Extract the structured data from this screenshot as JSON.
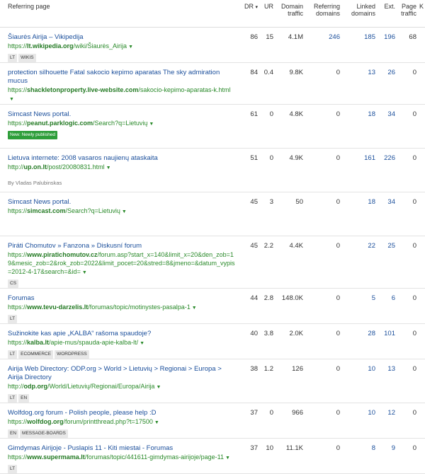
{
  "headers": {
    "page": "Referring page",
    "dr": "DR",
    "dr_sort": "▾",
    "ur": "UR",
    "traffic": "Domain traffic",
    "ref_domains": "Referring domains",
    "linked": "Linked domains",
    "ext": "Ext.",
    "page_traffic": "Page traffic",
    "kw": "K"
  },
  "rows": [
    {
      "title": "Šiaurės Airija – Vikipedija",
      "url_pre": "https://",
      "url_domain": "lt.wikipedia.org",
      "url_path": "/wiki/Šiaurės_Airija",
      "tags": [
        "LT",
        "WIKIS"
      ],
      "author": "",
      "dr": "86",
      "ur": "15",
      "traffic": "4.1M",
      "ref": "246",
      "linked": "185",
      "ext": "196",
      "pt": "68"
    },
    {
      "title": "protection silhouette Fatal sakocio kepimo aparatas The sky admiration mucus",
      "url_pre": "https://",
      "url_domain": "shackletonproperty.live-website.com",
      "url_path": "/sakocio-kepimo-aparatas-k.html",
      "tags": [],
      "author": "",
      "dr": "84",
      "ur": "0.4",
      "traffic": "9.8K",
      "ref": "0",
      "linked": "13",
      "ext": "26",
      "pt": "0"
    },
    {
      "title": "Simcast News portal.",
      "url_pre": "https://",
      "url_domain": "peanut.parklogic.com",
      "url_path": "/Search?q=Lietuvių",
      "tags": [
        "New: Newly published"
      ],
      "author": "",
      "dr": "61",
      "ur": "0",
      "traffic": "4.8K",
      "ref": "0",
      "linked": "18",
      "ext": "34",
      "pt": "0"
    },
    {
      "title": "Lietuva internete: 2008 vasaros naujienų ataskaita",
      "url_pre": "http://",
      "url_domain": "up.on.lt",
      "url_path": "/post/20080831.html",
      "tags": [],
      "author": "By Vladas Palubinskas",
      "dr": "51",
      "ur": "0",
      "traffic": "4.9K",
      "ref": "0",
      "linked": "161",
      "ext": "226",
      "pt": "0"
    },
    {
      "title": "Simcast News portal.",
      "url_pre": "https://",
      "url_domain": "simcast.com",
      "url_path": "/Search?q=Lietuvių",
      "tags": [],
      "author": "",
      "dr": "45",
      "ur": "3",
      "traffic": "50",
      "ref": "0",
      "linked": "18",
      "ext": "34",
      "pt": "0"
    },
    {
      "title": "Piráti Chomutov » Fanzona » Diskusní forum",
      "url_pre": "https://",
      "url_domain": "www.piratichomutov.cz",
      "url_path": "/forum.asp?start_x=140&limit_x=20&den_zob=19&mesic_zob=2&rok_zob=2022&limit_pocet=20&stred=8&jmeno=&datum_vypis=2012-4-17&search=&id=",
      "tags": [
        "CS"
      ],
      "author": "",
      "dr": "45",
      "ur": "2.2",
      "traffic": "4.4K",
      "ref": "0",
      "linked": "22",
      "ext": "25",
      "pt": "0"
    },
    {
      "title": "Forumas",
      "url_pre": "https://",
      "url_domain": "www.tevu-darzelis.lt",
      "url_path": "/forumas/topic/motinystes-pasalpa-1",
      "tags": [
        "LT"
      ],
      "author": "",
      "dr": "44",
      "ur": "2.8",
      "traffic": "148.0K",
      "ref": "0",
      "linked": "5",
      "ext": "6",
      "pt": "0"
    },
    {
      "title": "Sužinokite kas apie „KALBA“ rašoma spaudoje?",
      "url_pre": "https://",
      "url_domain": "kalba.lt",
      "url_path": "/apie-mus/spauda-apie-kalba-lt/",
      "tags": [
        "LT",
        "ECOMMERCE",
        "WORDPRESS"
      ],
      "author": "",
      "dr": "40",
      "ur": "3.8",
      "traffic": "2.0K",
      "ref": "0",
      "linked": "28",
      "ext": "101",
      "pt": "0"
    },
    {
      "title": "Airija Web Directory: ODP.org > World > Lietuvių > Regionai > Europa > Airija Directory",
      "url_pre": "http://",
      "url_domain": "odp.org",
      "url_path": "/World/Lietuvių/Regionai/Europa/Airija",
      "tags": [
        "LT",
        "EN"
      ],
      "author": "",
      "dr": "38",
      "ur": "1.2",
      "traffic": "126",
      "ref": "0",
      "linked": "10",
      "ext": "13",
      "pt": "0"
    },
    {
      "title": "Wolfdog.org forum - Polish people, please help :D",
      "url_pre": "https://",
      "url_domain": "wolfdog.org",
      "url_path": "/forum/printthread.php?t=17500",
      "tags": [
        "EN",
        "MESSAGE-BOARDS"
      ],
      "author": "",
      "dr": "37",
      "ur": "0",
      "traffic": "966",
      "ref": "0",
      "linked": "10",
      "ext": "12",
      "pt": "0"
    },
    {
      "title": "Gimdymas Airijoje - Puslapis 11 - Kiti miestai - Forumas",
      "url_pre": "https://",
      "url_domain": "www.supermama.lt",
      "url_path": "/forumas/topic/441611-gimdymas-airijoje/page-11",
      "tags": [
        "LT"
      ],
      "author": "",
      "dr": "37",
      "ur": "10",
      "traffic": "11.1K",
      "ref": "0",
      "linked": "8",
      "ext": "9",
      "pt": "0"
    }
  ]
}
